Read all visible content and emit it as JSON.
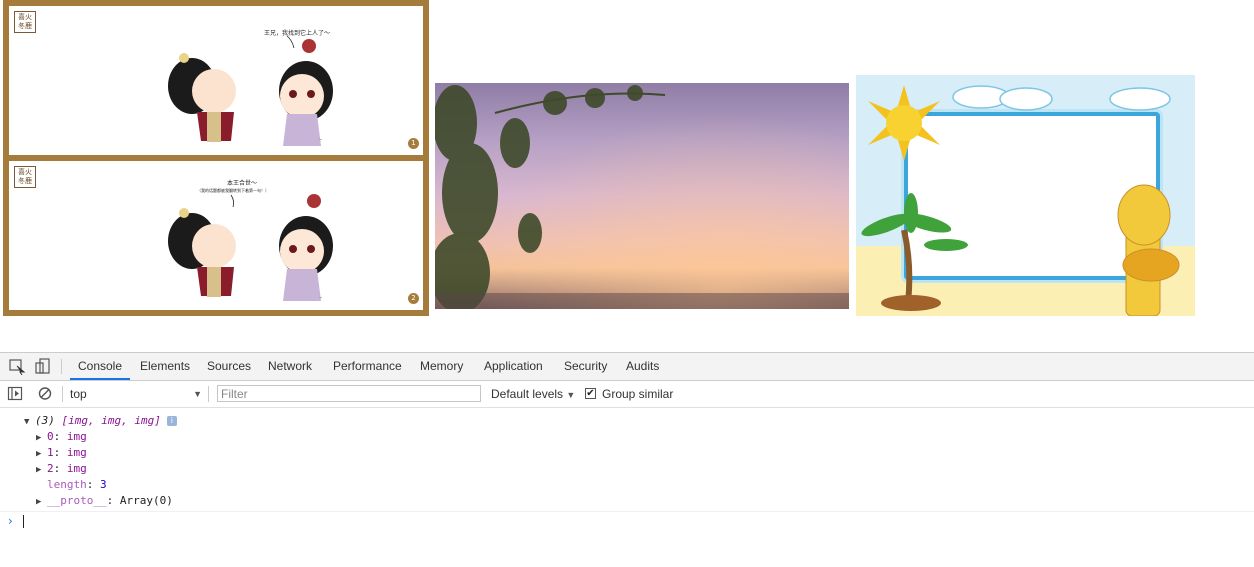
{
  "comic": {
    "seal_text": "喜火冬鹿",
    "panels": [
      {
        "number": "1",
        "speech": "王兄，我找到它上人了～"
      },
      {
        "number": "2",
        "speech": "本王合世～",
        "speech_sub": "（我的话题都被我翻转到下着第一句！）"
      }
    ]
  },
  "devtools": {
    "tabs": [
      {
        "label": "Console",
        "active": true
      },
      {
        "label": "Elements"
      },
      {
        "label": "Sources"
      },
      {
        "label": "Network"
      },
      {
        "label": "Performance"
      },
      {
        "label": "Memory"
      },
      {
        "label": "Application"
      },
      {
        "label": "Security"
      },
      {
        "label": "Audits"
      }
    ],
    "toolbar": {
      "context": "top",
      "filter_placeholder": "Filter",
      "levels": "Default levels",
      "group_similar_label": "Group similar",
      "group_similar_checked": "✔"
    },
    "console": {
      "summary_count": "(3)",
      "summary_array": "[img, img, img]",
      "info_badge": "i",
      "items": [
        {
          "key": "0",
          "value": "img"
        },
        {
          "key": "1",
          "value": "img"
        },
        {
          "key": "2",
          "value": "img"
        }
      ],
      "length_key": "length",
      "length_value": "3",
      "proto_key": "__proto__",
      "proto_value": "Array(0)",
      "prompt": "›"
    }
  },
  "colors": {
    "accent": "#1a73e8",
    "object_key": "#881391",
    "frame_brown": "#a67c3d"
  },
  "icons": [
    "inspect-icon",
    "device-toolbar-icon",
    "sidebar-toggle-icon",
    "clear-console-icon",
    "dropdown-arrow-icon",
    "checkbox-icon",
    "info-icon",
    "expand-triangle-icon"
  ]
}
